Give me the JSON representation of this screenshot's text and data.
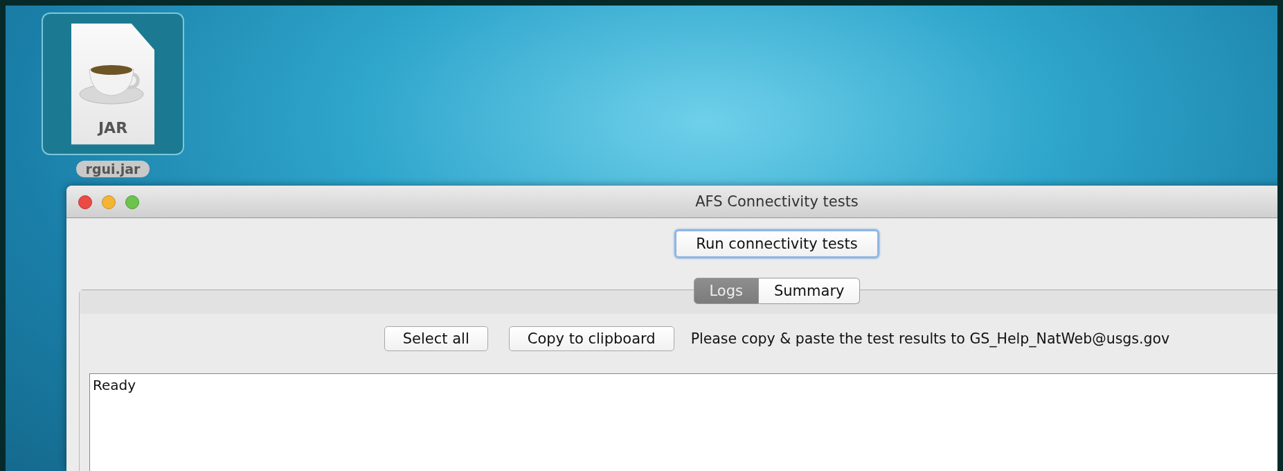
{
  "desktop_icons": [
    {
      "label": "rgui.jar",
      "badge": "JAR",
      "selected": true
    }
  ],
  "window": {
    "title": "AFS Connectivity tests"
  },
  "run_button": {
    "label": "Run connectivity tests",
    "focused": true
  },
  "tabs": [
    {
      "label": "Logs",
      "selected": true
    },
    {
      "label": "Summary",
      "selected": false
    }
  ],
  "log_toolbar": {
    "buttons": [
      "Select all",
      "Copy to clipboard"
    ],
    "note": "Please copy & paste the test results to GS_Help_NatWeb@usgs.gov"
  },
  "log_text": "Ready"
}
